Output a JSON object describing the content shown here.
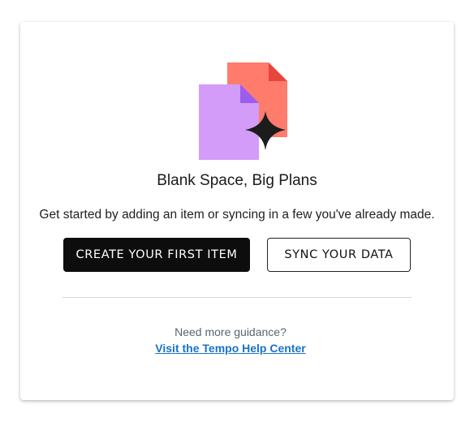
{
  "empty_state": {
    "title": "Blank Space, Big Plans",
    "description": "Get started by adding an item or syncing in a few you've already made.",
    "primary_button_label": "CREATE YOUR FIRST ITEM",
    "secondary_button_label": "SYNC YOUR DATA",
    "help_prompt": "Need more guidance?",
    "help_link_label": "Visit the Tempo Help Center"
  },
  "illustration": {
    "icon": "documents-sparkle-icon",
    "colors": {
      "back_document": "#ff7b6b",
      "back_document_fold": "#e8453c",
      "front_document": "#d29cf8",
      "front_document_fold": "#9b5cf0",
      "sparkle": "#1c1c1c"
    }
  },
  "colors": {
    "primary_button_bg": "#0d0d0d",
    "link": "#1a73c8",
    "muted_text": "#5a6470"
  }
}
